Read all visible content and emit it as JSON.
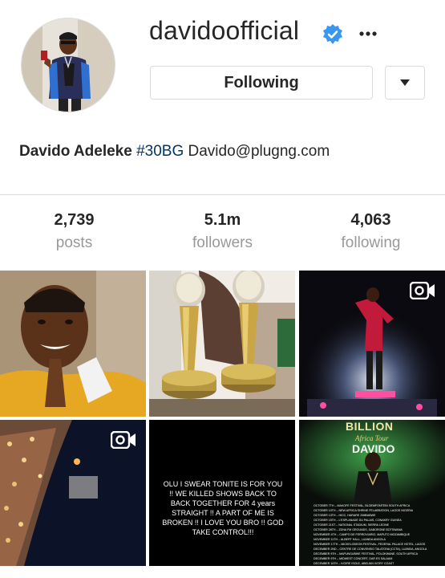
{
  "profile": {
    "username": "davidoofficial",
    "verified": true,
    "following_label": "Following",
    "bio_name": "Davido Adeleke",
    "bio_hashtag": "#30BG",
    "bio_contact": "Davido@plugng.com"
  },
  "stats": [
    {
      "value": "2,739",
      "label": "posts"
    },
    {
      "value": "5.1m",
      "label": "followers"
    },
    {
      "value": "4,063",
      "label": "following"
    }
  ],
  "icons": {
    "verified": "verified-badge-icon",
    "more": "more-options-icon",
    "dropdown": "chevron-down-icon",
    "video": "video-icon"
  },
  "colors": {
    "verified_blue": "#3897f0",
    "text": "#262626",
    "muted": "#999999",
    "hashtag": "#003569",
    "border": "#dbdbdb"
  },
  "posts": {
    "quote_text": "OLU I SWEAR TONITE IS FOR YOU !! WE KILLED SHOWS BACK TO BACK TOGETHER FOR 4 years STRAIGHT !! A PART OF ME IS BROKEN !! I LOVE YOU BRO !! GOD TAKE CONTROL!!!",
    "poster_title": "BILLION",
    "poster_subtitle": "Africa Tour",
    "poster_name": "DAVIDO",
    "poster_schedule": [
      "OCTOBER 7TH – MAKOFE FESTIVAL, BLOEMFONTEIN SOUTH AFRICA",
      "OCTOBER 10TH – NEW AFRICA SHRINE FELABRATION, LAGOS NIGERIA",
      "OCTOBER 13TH – HICC, HARARE ZIMBABWE",
      "OCTOBER 15TH – L'ESPLANADE DU PALAIS, CONAKRY GUINEA",
      "OCTOBER 21ST – NATIONAL STADIUM, SIERRA LEONE",
      "OCTOBER 28TH – ZDNA FM GROUNDS, GABORONE BOTSWANA",
      "NOVEMBER 4TH – CAMPO DE FERROVIARIO, MAPUTO MOZAMBIQUE",
      "NOVEMBER 11TH – ALBERT HALL, LUANDA ANGOLA",
      "NOVEMBER 17TH – MICKELODEON FESTIVAL, FEDERAL PALACE HOTEL, LAGOS",
      "DECEMBER 2ND – CENTRE DE CONVENSIO TALATONA (CCTA), LUANDA, ANGOLA",
      "DECEMBER 9TH – MAPUNGUBWE FESTIVAL, POLOKWANE, SOUTH AFRICA",
      "DECEMBER 9TH – MIDWEST CONCERT, DAR ES SALAAM",
      "DECEMBER 16TH – IVOIRE ISOLE, ABIDJAN IVORY COAST"
    ]
  }
}
